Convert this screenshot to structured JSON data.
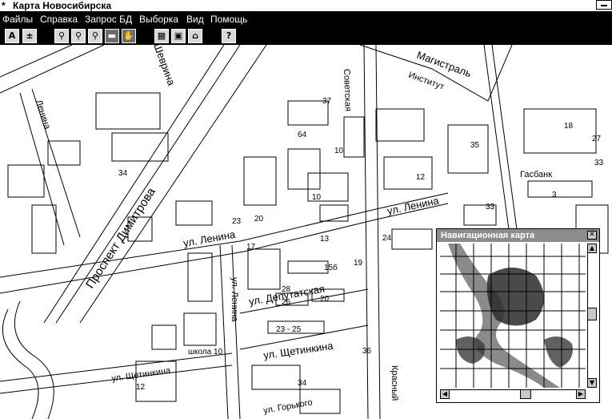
{
  "window": {
    "title": "Карта Новосибирска",
    "icon_glyph": "*"
  },
  "menu": [
    "Файлы",
    "Справка",
    "Запрос БД",
    "Выборка",
    "Вид",
    "Помощь"
  ],
  "toolbar": {
    "buttons": [
      {
        "icon": "text-tool-icon",
        "glyph": "A"
      },
      {
        "icon": "ruler-icon",
        "glyph": "±"
      },
      {
        "icon": "zoom-icon",
        "glyph": "⚲"
      },
      {
        "icon": "zoom-in-icon",
        "glyph": "⚲"
      },
      {
        "icon": "zoom-out-icon",
        "glyph": "⚲"
      },
      {
        "icon": "layer-icon",
        "glyph": "▬"
      },
      {
        "icon": "pan-icon",
        "glyph": "✋"
      },
      {
        "icon": "select-rect-icon",
        "glyph": "▦"
      },
      {
        "icon": "select-map-icon",
        "glyph": "▣"
      },
      {
        "icon": "home-icon",
        "glyph": "⌂"
      },
      {
        "icon": "help-icon",
        "glyph": "?"
      }
    ]
  },
  "map": {
    "street_labels": [
      "Проспект Димитрова",
      "ул. Ленина",
      "ул. Ленина",
      "ул. Депутатская",
      "ул. Щетинкина",
      "ул. Щетинкина",
      "Шеврина",
      "ул. Ленина",
      "Магистраль",
      "Институт",
      "Гасбанк",
      "ул. Горького",
      "Красный",
      "Советская",
      "Ленина"
    ],
    "house_numbers": [
      "37",
      "64",
      "12",
      "35",
      "18",
      "27",
      "3",
      "33",
      "24",
      "13",
      "15б",
      "19",
      "17",
      "28",
      "26",
      "20",
      "23 - 25",
      "36",
      "12",
      "34",
      "10",
      "10",
      "23",
      "20",
      "34",
      "школа 10",
      "33"
    ]
  },
  "nav_window": {
    "title": "Навигационная карта",
    "close_glyph": "✕"
  },
  "colors": {
    "menubar": "#000000",
    "toolbar": "#000000",
    "nav_title": "#8c8c8c",
    "river": "#8a8a8a"
  }
}
